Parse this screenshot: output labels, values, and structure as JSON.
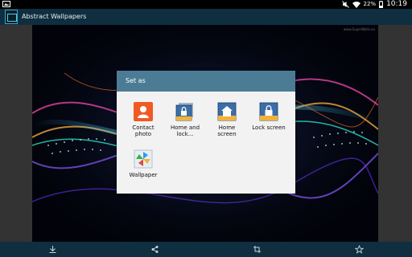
{
  "status_bar": {
    "battery_percent": "22%",
    "time": "10:19",
    "icons": [
      "screenshot-icon",
      "mute-icon",
      "wifi-icon",
      "battery-icon"
    ]
  },
  "action_bar": {
    "title": "Abstract Wallpapers",
    "app_icon": "abstract-wallpapers-app-icon"
  },
  "wallpaper": {
    "watermark": "www.SuperWalls.eu"
  },
  "dialog": {
    "title": "Set as",
    "options": [
      {
        "label_lines": [
          "Contact",
          "photo"
        ],
        "icon": "contact-photo-icon"
      },
      {
        "label_lines": [
          "Home and",
          "lock..."
        ],
        "icon": "home-and-lock-icon"
      },
      {
        "label_lines": [
          "Home",
          "screen"
        ],
        "icon": "home-screen-icon"
      },
      {
        "label_lines": [
          "Lock screen"
        ],
        "icon": "lock-screen-icon"
      },
      {
        "label_lines": [
          "Wallpaper"
        ],
        "icon": "wallpaper-icon"
      }
    ]
  },
  "bottom_bar": {
    "buttons": [
      "download-icon",
      "share-icon",
      "crop-icon",
      "favorite-icon"
    ]
  },
  "colors": {
    "action_bar": "#0f2f40",
    "dialog_header": "#4c7c95",
    "dialog_body": "#f2f2f2",
    "contact_tile": "#f05a22"
  }
}
